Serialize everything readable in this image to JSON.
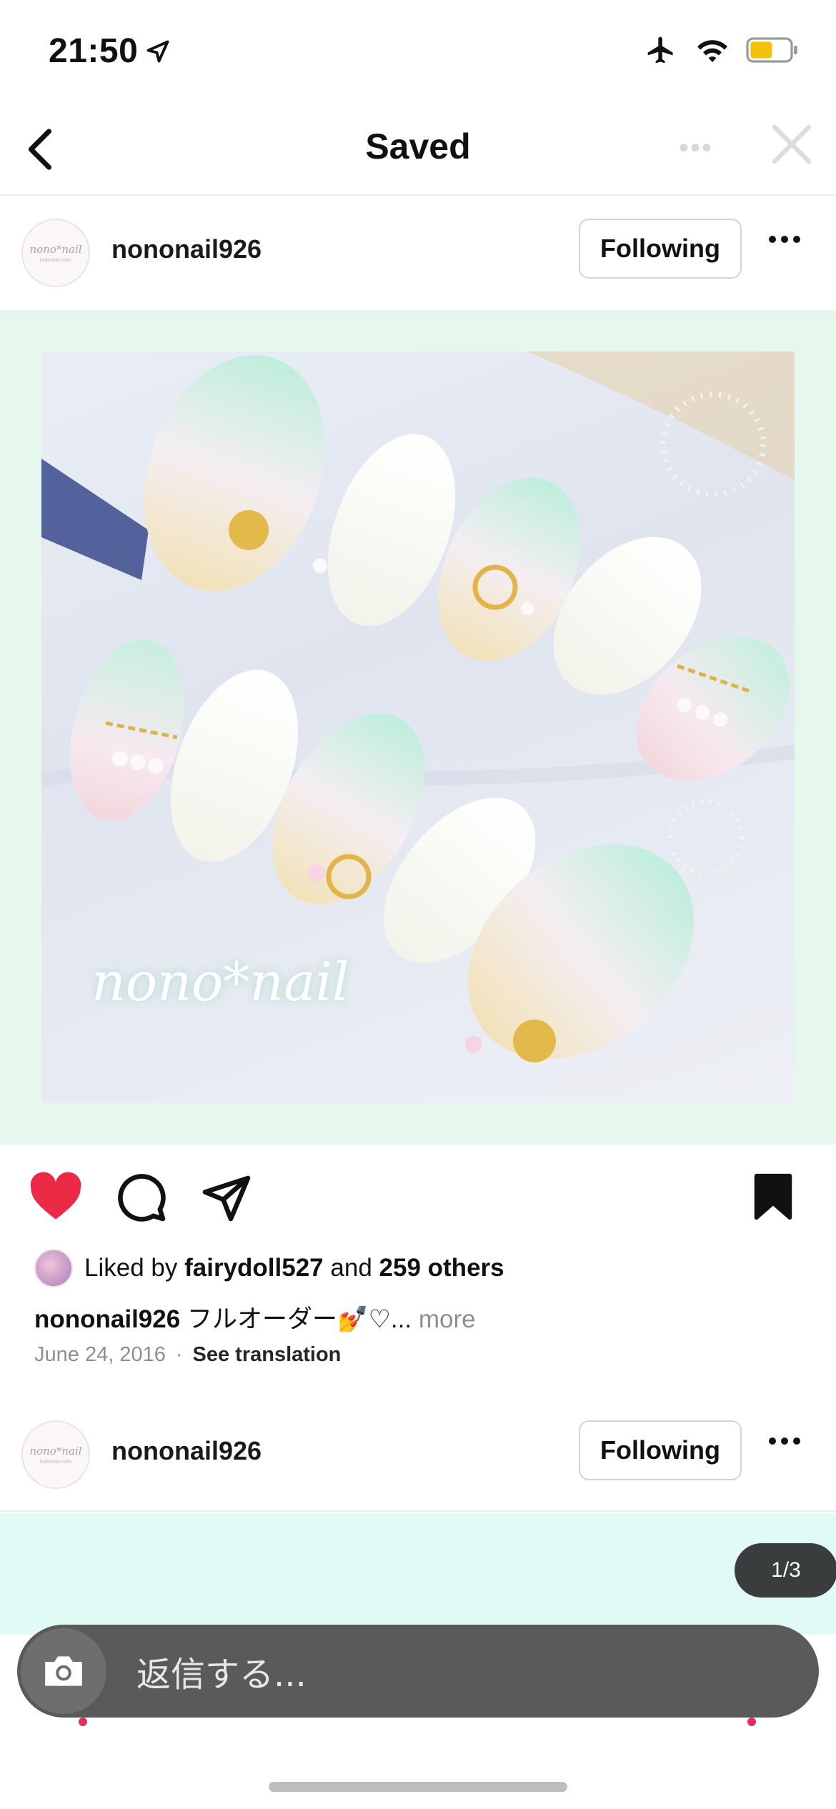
{
  "status_bar": {
    "time": "21:50",
    "battery_color": "#f4c20d"
  },
  "header": {
    "title": "Saved"
  },
  "posts": [
    {
      "avatar_text": "nono*nail",
      "avatar_sub": "hokkaido nails",
      "username": "nononail926",
      "follow_label": "Following",
      "image_watermark": "nono*nail",
      "liked_prefix": "Liked by",
      "liked_user": "fairydoll527",
      "liked_and": "and",
      "liked_others": "259 others",
      "caption_user": "nononail926",
      "caption_text": "フルオーダー💅♡...",
      "caption_more": "more",
      "date": "June 24, 2016",
      "separator": "·",
      "see_translation": "See translation",
      "liked": true,
      "saved": true
    },
    {
      "avatar_text": "nono*nail",
      "avatar_sub": "hokkaido nails",
      "username": "nononail926",
      "follow_label": "Following",
      "page_indicator": "1/3"
    }
  ],
  "reply": {
    "placeholder": "返信する..."
  },
  "colors": {
    "like": "#ed2a46",
    "frame_bg": "#e6f8ee",
    "post2_bg": "#e0fbf6"
  },
  "icons": {
    "back": "chevron-left-icon",
    "close": "close-icon",
    "like": "heart-icon",
    "comment": "comment-icon",
    "share": "send-icon",
    "save": "bookmark-icon",
    "camera": "camera-icon"
  }
}
